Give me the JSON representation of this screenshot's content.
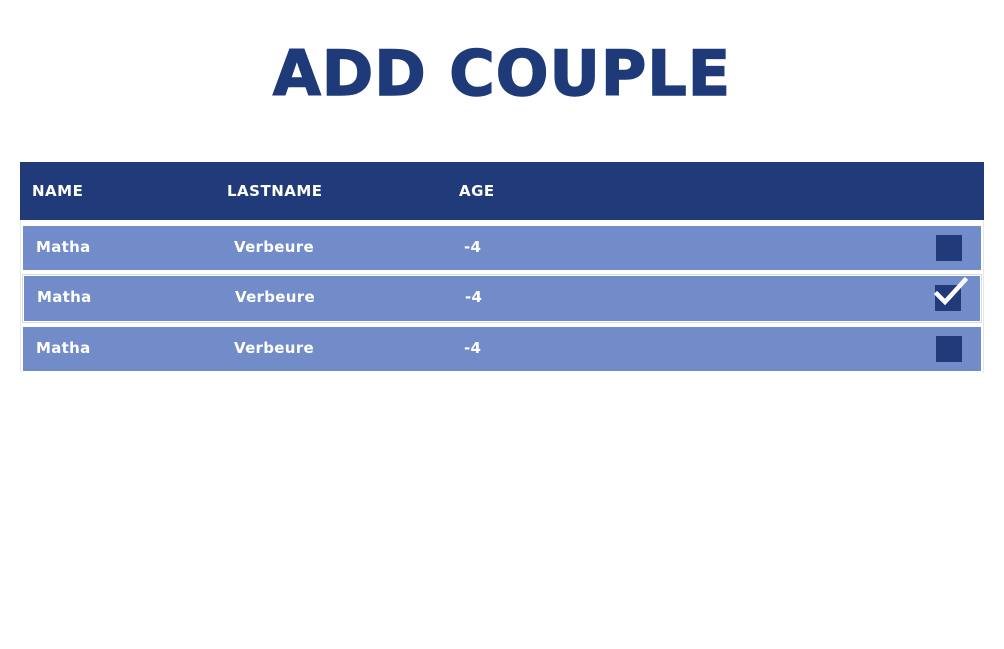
{
  "page": {
    "title": "ADD COUPLE"
  },
  "table": {
    "columns": [
      "NAME",
      "LASTNAME",
      "AGE"
    ],
    "rows": [
      {
        "name": "Matha",
        "lastname": "Verbeure",
        "age": "-4",
        "checked": false
      },
      {
        "name": "Matha",
        "lastname": "Verbeure",
        "age": "-4",
        "checked": true
      },
      {
        "name": "Matha",
        "lastname": "Verbeure",
        "age": "-4",
        "checked": false
      }
    ]
  },
  "colors": {
    "primary": "#213a79",
    "row": "#728bc9",
    "text_on_primary": "#ffffff"
  }
}
